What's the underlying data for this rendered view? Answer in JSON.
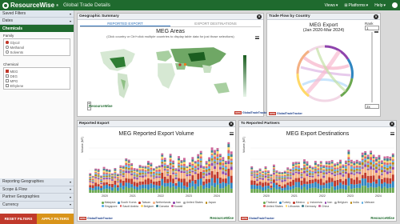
{
  "brand": {
    "name": "ResourceWise",
    "registered": "®",
    "app_title": "Global Trade Details"
  },
  "topnav": {
    "views": "Views",
    "platforms": "Platforms",
    "help": "Help"
  },
  "sidebar": {
    "saved_filters": "Saved Filters",
    "dates": "Dates",
    "chemicals": "Chemicals",
    "family_label": "Family",
    "family_options": [
      {
        "label": "Glycol",
        "selected": true
      },
      {
        "label": "Methanol",
        "selected": false
      },
      {
        "label": "Solvents",
        "selected": false
      }
    ],
    "chemical_label": "Chemical",
    "chemical_options": [
      {
        "label": "MEG",
        "checked": true
      },
      {
        "label": "DEG",
        "checked": false
      },
      {
        "label": "MPG",
        "checked": false
      },
      {
        "label": "Ethylene",
        "checked": false
      }
    ],
    "reporting_geographies": "Reporting Geographies",
    "scope_flow": "Scope & Flow",
    "partner_geographies": "Partner Geographies",
    "currency": "Currency",
    "reset_button": "RESET FILTERS",
    "apply_button": "APPLY FILTERS"
  },
  "geo": {
    "panel_title": "Geographic Summary",
    "tab_export": "REPORTED EXPORT",
    "tab_destinations": "EXPORT DESTINATIONS",
    "chart_title": "MEG Areas",
    "subtitle": "(Click country or Ctrl+click multiple countries to display table data for just those selections)",
    "zoom_in": "+",
    "zoom_out": "−"
  },
  "flow": {
    "panel_title": "Trade Flow by Country",
    "chart_title": "MEG Export",
    "chart_subtitle": "(Jan 2020-Mar 2024)",
    "rank_label": "Rank",
    "rank_value": "1",
    "rank_max": "2x"
  },
  "reported": {
    "panel_title": "Reported Export",
    "chart_title": "MEG Reported Export Volume",
    "ylabel": "Volume (MT)",
    "x_ticks": [
      "2020",
      "2021",
      "2022",
      "2023",
      "2024"
    ],
    "legend": [
      "Malaysia",
      "South Korea",
      "Taiwan",
      "Netherlands",
      "Iran",
      "United States",
      "Japan",
      "Singapore",
      "Saudi Arabia",
      "Belgium",
      "Canada",
      "Kuwait"
    ]
  },
  "partners": {
    "panel_title": "To Reported Partners",
    "chart_title": "MEG Export Destinations",
    "ylabel": "Volume (MT)",
    "x_ticks": [
      "2020",
      "2021",
      "2022",
      "2023",
      "2024"
    ],
    "legend": [
      "Thailand",
      "Turkey",
      "Mexico",
      "Indonesia",
      "Iran",
      "Belgium",
      "India",
      "Vietnam",
      "United States",
      "Lithuania",
      "Germany",
      "China"
    ]
  },
  "footer": {
    "badge_a": "OPIS",
    "badge_b": "GlobalTradeTracker",
    "brand": "ResourceWise"
  },
  "colors": {
    "brand_green": "#1f6a2e",
    "reset": "#c0392b",
    "apply": "#d9941a",
    "legend": [
      "#6aa84f",
      "#2e86c1",
      "#c0392b",
      "#f4b183",
      "#8e44ad",
      "#a6a6a6",
      "#b8860b",
      "#5dade2",
      "#e06666",
      "#ffd966",
      "#45818e",
      "#cc6699"
    ]
  },
  "chart_data": [
    {
      "type": "bar",
      "title": "MEG Reported Export Volume",
      "xlabel": "",
      "ylabel": "Volume (MT)",
      "x": [
        "2020",
        "2021",
        "2022",
        "2023",
        "2024"
      ],
      "series_count": 12
    },
    {
      "type": "bar",
      "title": "MEG Export Destinations",
      "xlabel": "",
      "ylabel": "Volume (MT)",
      "x": [
        "2020",
        "2021",
        "2022",
        "2023",
        "2024"
      ],
      "series_count": 12
    }
  ]
}
